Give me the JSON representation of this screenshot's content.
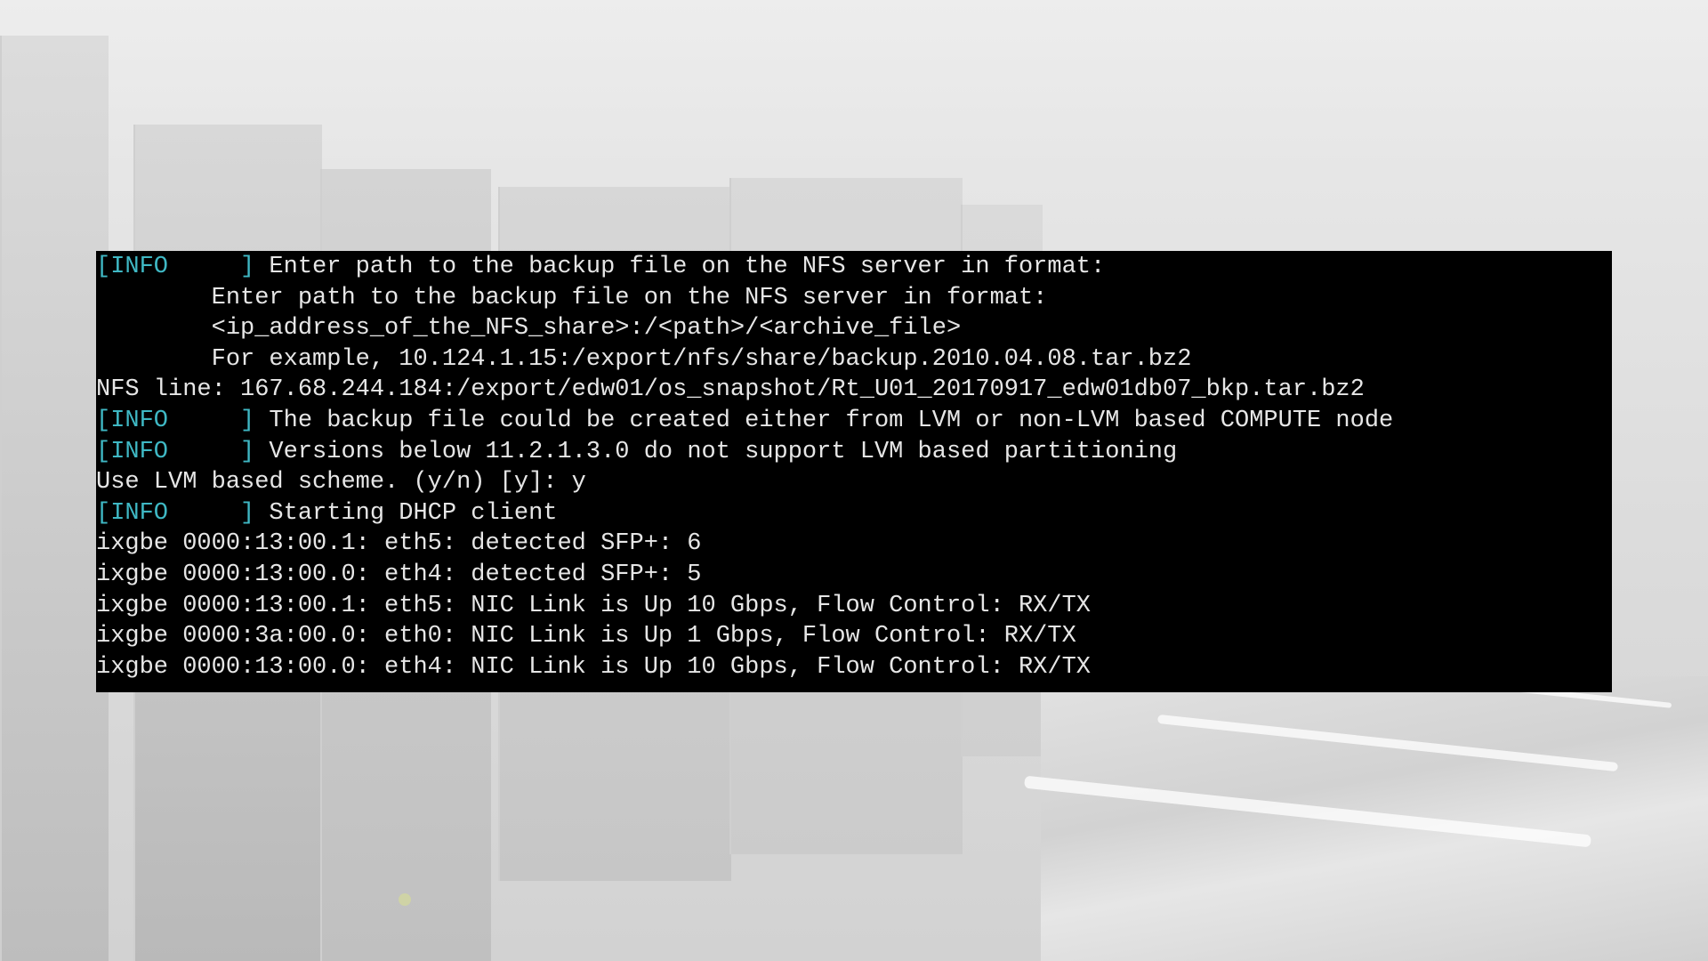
{
  "background": {
    "scene": "server-room-photo"
  },
  "terminal": {
    "colors": {
      "background": "#000000",
      "text": "#e6e6e6",
      "tag": "#3fb8c4",
      "cursor": "#19e619"
    },
    "lines": [
      {
        "tag": "[INFO",
        "tag_close": "     ]",
        "text": " Enter path to the backup file on the NFS server in format:"
      },
      {
        "text": "        Enter path to the backup file on the NFS server in format:"
      },
      {
        "text": "        <ip_address_of_the_NFS_share>:/<path>/<archive_file>"
      },
      {
        "text": "        For example, 10.124.1.15:/export/nfs/share/backup.2010.04.08.tar.bz2"
      },
      {
        "text": "NFS line: 167.68.244.184:/export/edw01/os_snapshot/Rt_U01_20170917_edw01db07_bkp.tar.bz2"
      },
      {
        "tag": "[INFO",
        "tag_close": "     ]",
        "text": " The backup file could be created either from LVM or non-LVM based COMPUTE node"
      },
      {
        "tag": "[INFO",
        "tag_close": "     ]",
        "text": " Versions below 11.2.1.3.0 do not support LVM based partitioning"
      },
      {
        "text": "Use LVM based scheme. (y/n) [y]: y"
      },
      {
        "tag": "[INFO",
        "tag_close": "     ]",
        "text": " Starting DHCP client"
      },
      {
        "text": "ixgbe 0000:13:00.1: eth5: detected SFP+: 6"
      },
      {
        "text": "ixgbe 0000:13:00.0: eth4: detected SFP+: 5"
      },
      {
        "text": "ixgbe 0000:13:00.1: eth5: NIC Link is Up 10 Gbps, Flow Control: RX/TX"
      },
      {
        "text": "ixgbe 0000:3a:00.0: eth0: NIC Link is Up 1 Gbps, Flow Control: RX/TX"
      },
      {
        "text": "ixgbe 0000:13:00.0: eth4: NIC Link is Up 10 Gbps, Flow Control: RX/TX"
      }
    ]
  }
}
